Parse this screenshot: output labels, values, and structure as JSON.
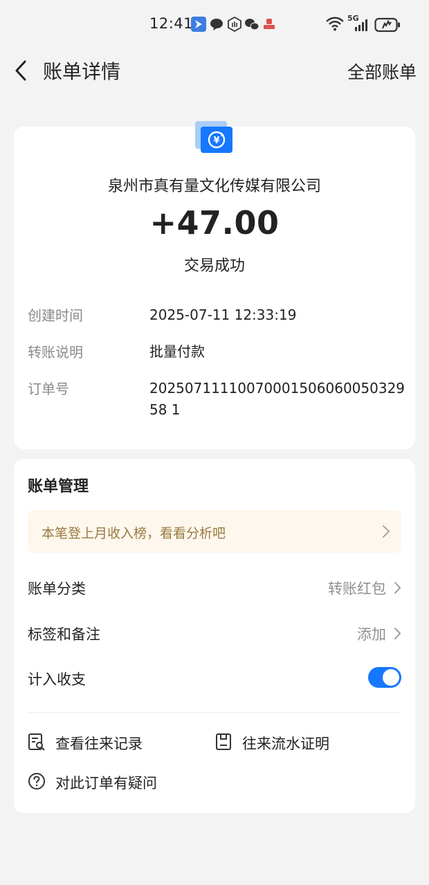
{
  "status_bar": {
    "time": "12:41",
    "network": "5G"
  },
  "nav": {
    "title": "账单详情",
    "right_link": "全部账单"
  },
  "transaction": {
    "merchant": "泉州市真有量文化传媒有限公司",
    "amount": "+47.00",
    "status": "交易成功",
    "icon": "yuan-refresh-icon",
    "icon_color": "#1677ff",
    "details": [
      {
        "label": "创建时间",
        "value": "2025-07-11 12:33:19"
      },
      {
        "label": "转账说明",
        "value": "批量付款"
      },
      {
        "label": "订单号",
        "value": "2025071111007000150606005032958 1"
      }
    ]
  },
  "management": {
    "title": "账单管理",
    "tip": "本笔登上月收入榜，看看分析吧",
    "category_label": "账单分类",
    "category_value": "转账红包",
    "tags_label": "标签和备注",
    "tags_value": "添加",
    "include_label": "计入收支",
    "include_enabled": true,
    "toggle_color": "#1677ff",
    "links": {
      "history": "查看往来记录",
      "proof": "往来流水证明",
      "question": "对此订单有疑问"
    }
  }
}
